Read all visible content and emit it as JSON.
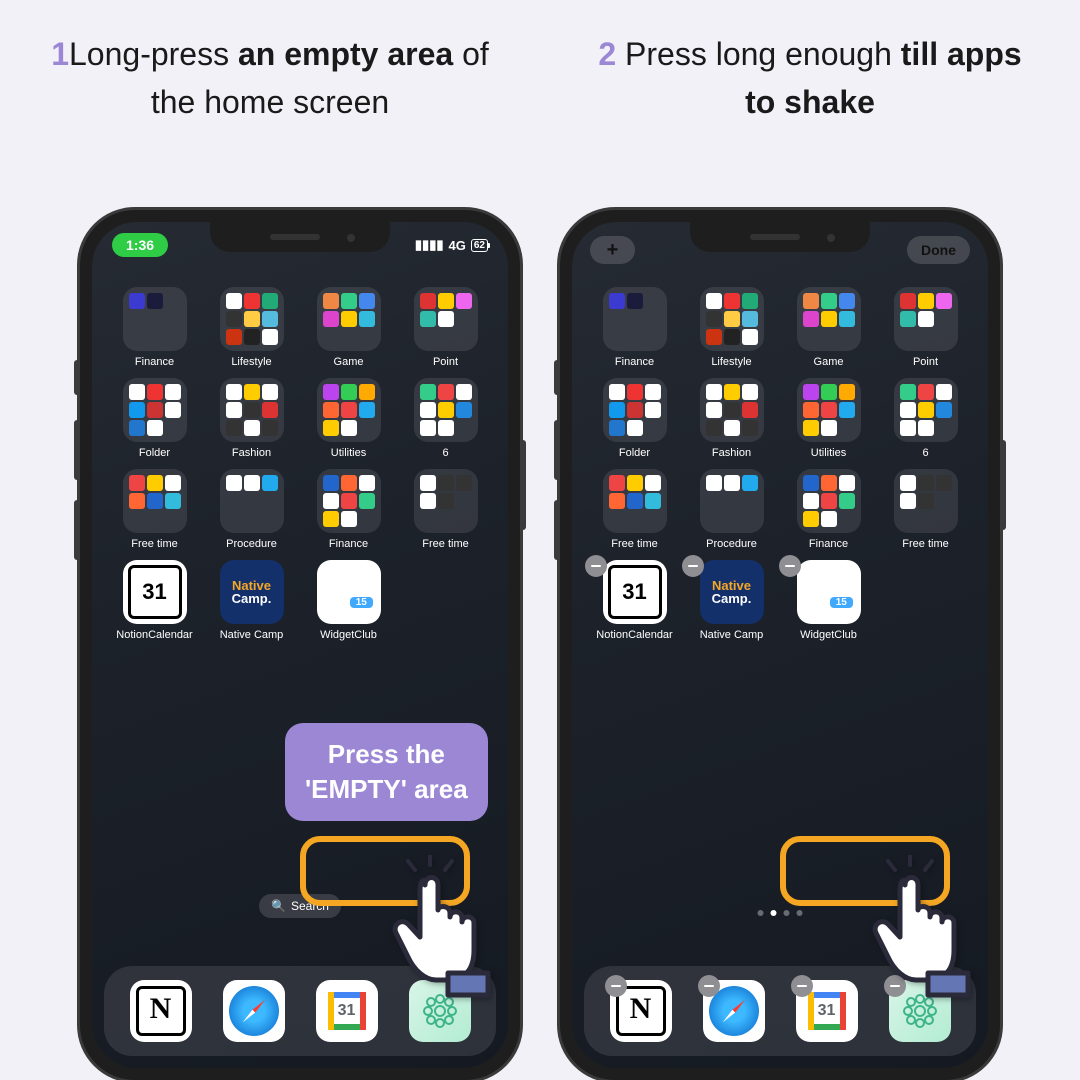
{
  "instructions": {
    "step1": {
      "num": "1",
      "a": "Long-press ",
      "b": "an empty area",
      "c": " of the home screen"
    },
    "step2": {
      "num": "2",
      "a": " Press long enough ",
      "b": "till apps to shake"
    }
  },
  "phone1": {
    "time": "1:36",
    "network": "4G",
    "battery": "62",
    "search": "Search",
    "callout": {
      "l1": "Press the",
      "l2": "'EMPTY' area"
    }
  },
  "phone2": {
    "plus": "+",
    "done": "Done"
  },
  "folders": [
    {
      "label": "Finance"
    },
    {
      "label": "Lifestyle"
    },
    {
      "label": "Game"
    },
    {
      "label": "Point"
    },
    {
      "label": "Folder"
    },
    {
      "label": "Fashion"
    },
    {
      "label": "Utilities"
    },
    {
      "label": "6"
    },
    {
      "label": "Free time"
    },
    {
      "label": "Procedure"
    },
    {
      "label": "Finance"
    },
    {
      "label": "Free time"
    }
  ],
  "apps": [
    {
      "label": "NotionCalendar",
      "day": "31"
    },
    {
      "label": "Native Camp",
      "l1": "Native",
      "l2": "Camp."
    },
    {
      "label": "WidgetClub"
    }
  ],
  "gcal_day": "31",
  "folder_minis": {
    "Finance": [
      "#3b3bd1",
      "#1b1b3b",
      "",
      "",
      "",
      "",
      "",
      "",
      ""
    ],
    "Lifestyle": [
      "#fff",
      "#e33",
      "#2a7",
      "#333",
      "#fc4",
      "#5bd",
      "#c31",
      "#222",
      "#fff"
    ],
    "Game": [
      "#e84",
      "#3c8",
      "#48e",
      "#d4c",
      "#fc0",
      "#3bd",
      "",
      "",
      ""
    ],
    "Point": [
      "#d33",
      "#fc0",
      "#e6e",
      "#3ba",
      "#fff",
      "",
      "",
      "",
      ""
    ],
    "Folder": [
      "#fff",
      "#e33",
      "#fff",
      "#19e",
      "#c33",
      "#fff",
      "#27c",
      "#fff",
      ""
    ],
    "Fashion": [
      "#fff",
      "#fc0",
      "#fff",
      "#fff",
      "#333",
      "#d33",
      "#333",
      "#fff",
      "#333"
    ],
    "Utilities": [
      "#b4e",
      "#3c5",
      "#fa0",
      "#f63",
      "#e44",
      "#2ae",
      "#fc0",
      "#fff",
      ""
    ],
    "6": [
      "#3c8",
      "#e44",
      "#fff",
      "#fff",
      "#fc0",
      "#28d",
      "#fff",
      "#fff",
      ""
    ],
    "Free time": [
      "#e44",
      "#fc0",
      "#fff",
      "#f63",
      "#26c",
      "#3bd",
      "",
      "",
      ""
    ],
    "Procedure": [
      "#fff",
      "#fff",
      "#2ae",
      "",
      "",
      "",
      "",
      "",
      ""
    ],
    "Finance2": [
      "#26c",
      "#f63",
      "#fff",
      "#fff",
      "#e44",
      "#3c8",
      "#fc0",
      "#fff",
      ""
    ],
    "Free time2": [
      "#fff",
      "#333",
      "#333",
      "#fff",
      "#333",
      "",
      "",
      "",
      ""
    ]
  }
}
